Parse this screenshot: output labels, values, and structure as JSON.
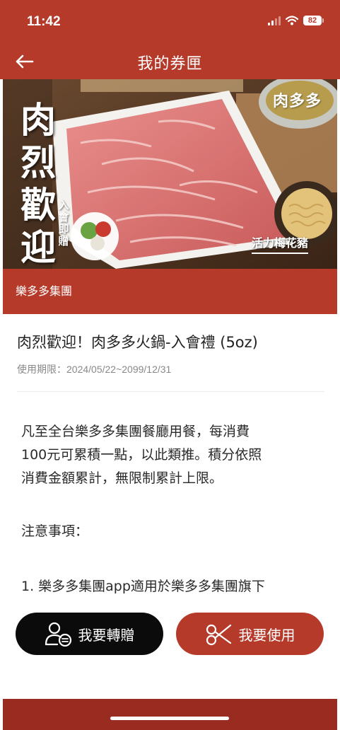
{
  "status_bar": {
    "time": "11:42",
    "battery": "82",
    "icons": [
      "signal-icon",
      "wifi-icon",
      "battery-icon"
    ]
  },
  "header": {
    "back_icon": "arrow-left-icon",
    "title": "我的券匣"
  },
  "banner": {
    "headline_chars": [
      "肉",
      "烈",
      "歡",
      "迎"
    ],
    "subline": "入會即贈",
    "brand_logo": "肉多多",
    "product_tag": "活力梅花豬"
  },
  "coupon": {
    "brand": "樂多多集團",
    "title": "肉烈歡迎！肉多多火鍋-入會禮 (5oz)",
    "validity": "使用期限：2024/05/22~2099/12/31",
    "description_lines": [
      "凡至全台樂多多集團餐廳用餐，每消費",
      "100元可累積一點，以此類推。積分依照",
      "消費金額累計，無限制累計上限。"
    ],
    "notice_heading": "注意事項：",
    "rules": [
      "1. 樂多多集團app適用於樂多多集團旗下"
    ]
  },
  "actions": {
    "transfer_label": "我要轉贈",
    "use_label": "我要使用",
    "transfer_icon": "gift-transfer-icon",
    "use_icon": "scissors-icon"
  },
  "colors": {
    "brand_red": "#b53a2a",
    "button_black": "#0b0b0b",
    "bottom_bar": "#9a2b20"
  }
}
